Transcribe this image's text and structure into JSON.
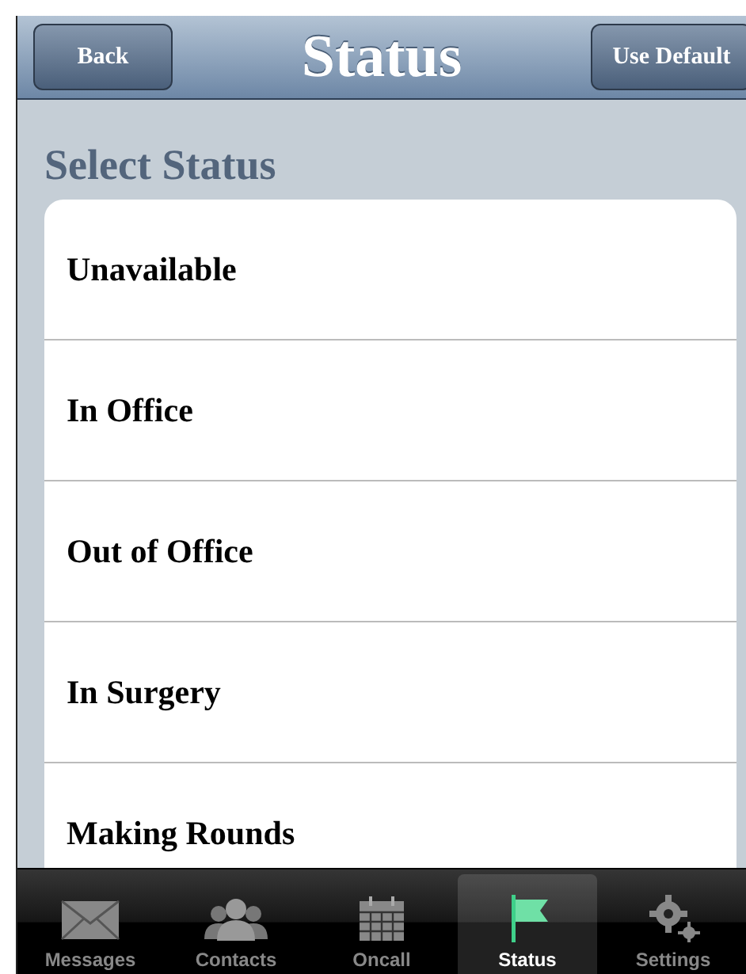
{
  "nav_bar": {
    "back_button": "Back",
    "title": "Status",
    "right_button": "Use Default"
  },
  "section_title": "Select Status",
  "statuses": [
    {
      "label": "Unavailable"
    },
    {
      "label": "In Office"
    },
    {
      "label": "Out of Office"
    },
    {
      "label": "In Surgery"
    },
    {
      "label": "Making Rounds"
    }
  ],
  "tab_bar": [
    {
      "label": "Messages",
      "kind": "envelope",
      "selected": false
    },
    {
      "label": "Contacts",
      "kind": "people",
      "selected": false
    },
    {
      "label": "Oncall",
      "kind": "calendar",
      "selected": false
    },
    {
      "label": "Status",
      "kind": "flag",
      "selected": true
    },
    {
      "label": "Settings",
      "kind": "gears",
      "selected": false
    }
  ]
}
